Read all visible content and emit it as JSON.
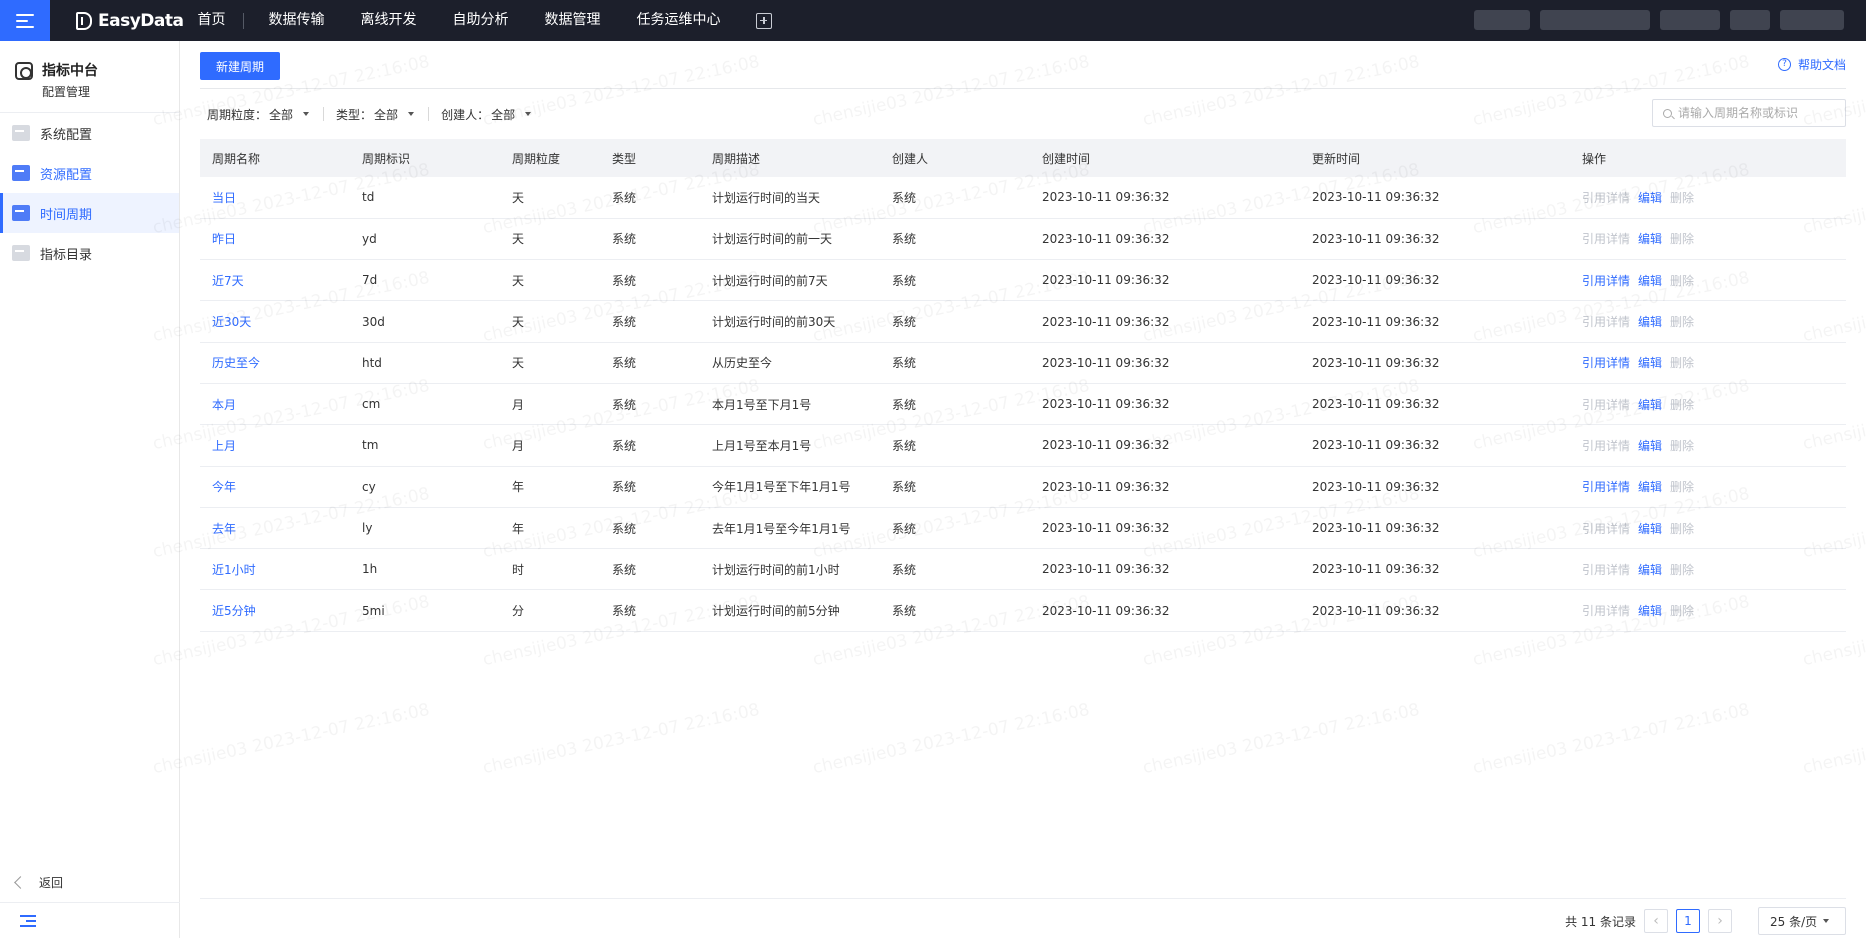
{
  "topbar": {
    "brand": "EasyData",
    "nav": [
      "首页",
      "数据传输",
      "离线开发",
      "自助分析",
      "数据管理",
      "任务运维中心"
    ]
  },
  "sidebar": {
    "title": "指标中台",
    "subtitle": "配置管理",
    "items": [
      {
        "label": "系统配置",
        "icon": "system-config-icon"
      },
      {
        "label": "资源配置",
        "icon": "resource-config-icon"
      },
      {
        "label": "时间周期",
        "icon": "calendar-icon"
      },
      {
        "label": "指标目录",
        "icon": "catalog-icon"
      }
    ],
    "back": "返回"
  },
  "toolbar": {
    "new_button": "新建周期",
    "help": "帮助文档"
  },
  "filters": [
    {
      "label": "周期粒度：",
      "value": "全部"
    },
    {
      "label": "类型：",
      "value": "全部"
    },
    {
      "label": "创建人：",
      "value": "全部"
    }
  ],
  "search": {
    "placeholder": "请输入周期名称或标识"
  },
  "table": {
    "columns": [
      "周期名称",
      "周期标识",
      "周期粒度",
      "类型",
      "周期描述",
      "创建人",
      "创建时间",
      "更新时间",
      "操作"
    ],
    "ops": [
      "引用详情",
      "编辑",
      "删除"
    ],
    "rows": [
      {
        "name": "当日",
        "code": "td",
        "grain": "天",
        "type": "系统",
        "desc": "计划运行时间的当天",
        "creator": "系统",
        "created": "2023-10-11 09:36:32",
        "updated": "2023-10-11 09:36:32",
        "ref_enabled": false
      },
      {
        "name": "昨日",
        "code": "yd",
        "grain": "天",
        "type": "系统",
        "desc": "计划运行时间的前一天",
        "creator": "系统",
        "created": "2023-10-11 09:36:32",
        "updated": "2023-10-11 09:36:32",
        "ref_enabled": false
      },
      {
        "name": "近7天",
        "code": "7d",
        "grain": "天",
        "type": "系统",
        "desc": "计划运行时间的前7天",
        "creator": "系统",
        "created": "2023-10-11 09:36:32",
        "updated": "2023-10-11 09:36:32",
        "ref_enabled": true
      },
      {
        "name": "近30天",
        "code": "30d",
        "grain": "天",
        "type": "系统",
        "desc": "计划运行时间的前30天",
        "creator": "系统",
        "created": "2023-10-11 09:36:32",
        "updated": "2023-10-11 09:36:32",
        "ref_enabled": false
      },
      {
        "name": "历史至今",
        "code": "htd",
        "grain": "天",
        "type": "系统",
        "desc": "从历史至今",
        "creator": "系统",
        "created": "2023-10-11 09:36:32",
        "updated": "2023-10-11 09:36:32",
        "ref_enabled": true
      },
      {
        "name": "本月",
        "code": "cm",
        "grain": "月",
        "type": "系统",
        "desc": "本月1号至下月1号",
        "creator": "系统",
        "created": "2023-10-11 09:36:32",
        "updated": "2023-10-11 09:36:32",
        "ref_enabled": false
      },
      {
        "name": "上月",
        "code": "tm",
        "grain": "月",
        "type": "系统",
        "desc": "上月1号至本月1号",
        "creator": "系统",
        "created": "2023-10-11 09:36:32",
        "updated": "2023-10-11 09:36:32",
        "ref_enabled": false
      },
      {
        "name": "今年",
        "code": "cy",
        "grain": "年",
        "type": "系统",
        "desc": "今年1月1号至下年1月1号",
        "creator": "系统",
        "created": "2023-10-11 09:36:32",
        "updated": "2023-10-11 09:36:32",
        "ref_enabled": true
      },
      {
        "name": "去年",
        "code": "ly",
        "grain": "年",
        "type": "系统",
        "desc": "去年1月1号至今年1月1号",
        "creator": "系统",
        "created": "2023-10-11 09:36:32",
        "updated": "2023-10-11 09:36:32",
        "ref_enabled": false
      },
      {
        "name": "近1小时",
        "code": "1h",
        "grain": "时",
        "type": "系统",
        "desc": "计划运行时间的前1小时",
        "creator": "系统",
        "created": "2023-10-11 09:36:32",
        "updated": "2023-10-11 09:36:32",
        "ref_enabled": false
      },
      {
        "name": "近5分钟",
        "code": "5mi",
        "grain": "分",
        "type": "系统",
        "desc": "计划运行时间的前5分钟",
        "creator": "系统",
        "created": "2023-10-11 09:36:32",
        "updated": "2023-10-11 09:36:32",
        "ref_enabled": false
      }
    ]
  },
  "pagination": {
    "total": "共 11 条记录",
    "current": "1",
    "page_size": "25 条/页"
  },
  "watermark": "chensijie03 2023-12-07 22:16:08",
  "colors": {
    "primary": "#2f6bff",
    "topbar": "#1c1f2b",
    "disabled": "#c0c4cc"
  }
}
